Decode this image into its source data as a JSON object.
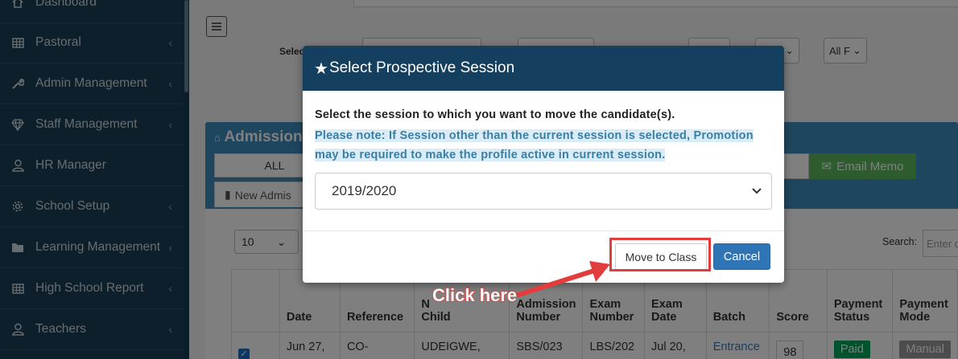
{
  "sidebar": {
    "items": [
      {
        "label": "Dashboard",
        "icon": "home-icon",
        "has_chevron": false
      },
      {
        "label": "Pastoral",
        "icon": "table-icon",
        "has_chevron": true
      },
      {
        "label": "Admin Management",
        "icon": "wrench-icon",
        "has_chevron": true
      },
      {
        "label": "Staff Management",
        "icon": "diamond-icon",
        "has_chevron": true
      },
      {
        "label": "HR Manager",
        "icon": "user-icon",
        "has_chevron": false
      },
      {
        "label": "School Setup",
        "icon": "gear-icon",
        "has_chevron": true
      },
      {
        "label": "Learning Management",
        "icon": "folder-icon",
        "has_chevron": true
      },
      {
        "label": "High School Report",
        "icon": "table-icon",
        "has_chevron": true
      },
      {
        "label": "Teachers",
        "icon": "user-icon",
        "has_chevron": true
      }
    ]
  },
  "background": {
    "select_label": "Selec",
    "filter_select_value": "All F",
    "panel_title": "Admission",
    "all_tab": "ALL",
    "new_tab": "New Admis",
    "email_button": "Email Memo",
    "page_length": "10",
    "search_label": "Search:",
    "search_placeholder": "Enter c",
    "table": {
      "headers": [
        "",
        "Date",
        "Reference",
        "N\nChild",
        "Admission Number",
        "Exam Number",
        "Exam Date",
        "Batch",
        "Score",
        "Payment Status",
        "Payment Mode"
      ],
      "row": {
        "checked": true,
        "date": "Jun 27,",
        "reference": "CO-",
        "child": "UDEIGWE,",
        "admission_number": "SBS/023",
        "exam_number": "LBS/202",
        "exam_date": "Jul 20,",
        "batch": "Entrance",
        "score": "98",
        "payment_status": "Paid",
        "payment_mode": "Manual"
      }
    }
  },
  "modal": {
    "title": "Select Prospective Session",
    "instruction": "Select the session to which you want to move the candidate(s).",
    "note_line1": "Please note: If Session other than the current session is selected, Promotion",
    "note_line2": "may be required to make the profile active in current session.",
    "session_value": "2019/2020",
    "move_button": "Move to Class",
    "cancel_button": "Cancel"
  },
  "annotation": {
    "label": "Click here",
    "color": "#e23c3c"
  },
  "colors": {
    "sidebar_bg": "#1a3f56",
    "modal_header_bg": "#143f5e",
    "primary_button": "#2f74b5",
    "email_button": "#5cb85c"
  }
}
